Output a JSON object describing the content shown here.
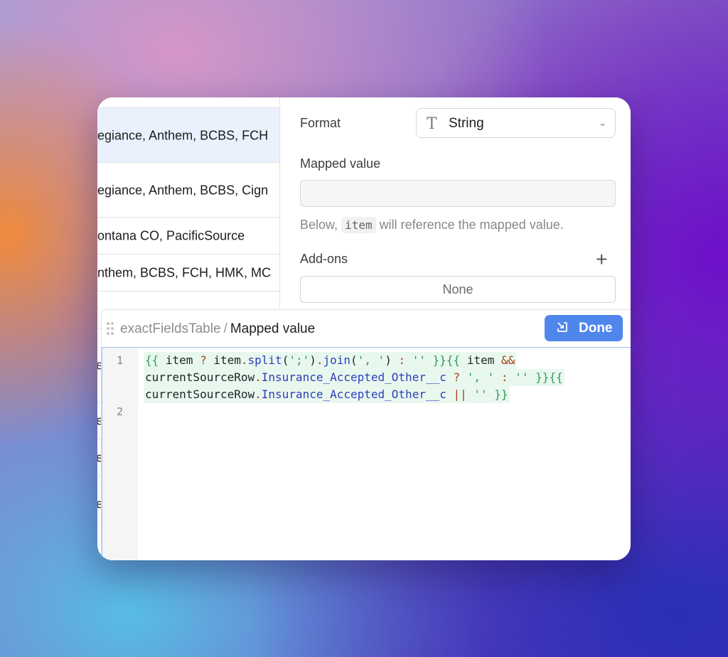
{
  "table": {
    "rows": [
      "egiance, Anthem, BCBS, FCH",
      "egiance, Anthem, BCBS, Cign",
      "ontana CO, PacificSource",
      "nthem, BCBS, FCH, HMK, MC",
      "",
      "e",
      "e",
      "e",
      "e"
    ]
  },
  "settings": {
    "format_label": "Format",
    "format_value": "String",
    "mapped_value_label": "Mapped value",
    "mapped_value_input": "",
    "help_prefix": "Below,",
    "help_code": "item",
    "help_suffix": "will reference the mapped value.",
    "addons_label": "Add-ons",
    "addons_value": "None"
  },
  "editor": {
    "breadcrumb_parent": "exactFieldsTable",
    "breadcrumb_separator": "/",
    "breadcrumb_current": "Mapped value",
    "done_label": "Done",
    "line_numbers": [
      "1",
      "2"
    ],
    "code": {
      "l1_open": "{{",
      "l1_item": " item ",
      "l1_q": "?",
      "l1_item2": " item",
      "l1_dot1": ".",
      "l1_split": "split",
      "l1_p1": "(",
      "l1_str1": "';'",
      "l1_p2": ")",
      "l1_dot2": ".",
      "l1_join": "join",
      "l1_p3": "(",
      "l1_str2": "', '",
      "l1_p4": ") ",
      "l1_colon": ":",
      "l1_str3": " '' ",
      "l1_close": "}}{{",
      "l1_item3": " item ",
      "l1_and": "&&",
      "l2_row": "currentSourceRow",
      "l2_dot": ".",
      "l2_field": "Insurance_Accepted_Other__c",
      "l2_q": " ?",
      "l2_str1": " ', '",
      "l2_colon": " :",
      "l2_str2": " '' ",
      "l2_close": "}}{{",
      "l3_row": "currentSourceRow",
      "l3_dot": ".",
      "l3_field": "Insurance_Accepted_Other__c",
      "l3_or": " ||",
      "l3_str": " '' ",
      "l3_close": "}}"
    }
  }
}
